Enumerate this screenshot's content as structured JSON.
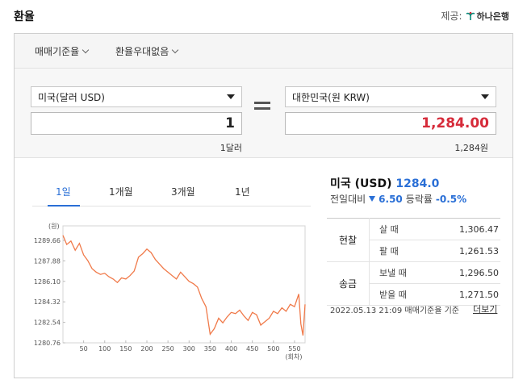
{
  "header": {
    "title": "환율",
    "provider_label": "제공:",
    "provider_name": "하나은행"
  },
  "options": {
    "rate_basis": "매매기준율",
    "preferential": "환율우대없음"
  },
  "converter": {
    "from_currency": "미국(달러 USD)",
    "from_amount": "1",
    "from_sub": "1달러",
    "to_currency": "대한민국(원 KRW)",
    "to_amount": "1,284.00",
    "to_sub": "1,284원"
  },
  "tabs": [
    {
      "label": "1일",
      "active": true
    },
    {
      "label": "1개월"
    },
    {
      "label": "3개월"
    },
    {
      "label": "1년"
    }
  ],
  "info": {
    "currency": "미국 (USD)",
    "rate": "1284.0",
    "change_label": "전일대비",
    "change_value": "6.50",
    "change_direction": "down",
    "pct_label": "등락률",
    "pct_value": "-0.5%"
  },
  "rates_table": {
    "groups": [
      {
        "name": "현찰",
        "rows": [
          {
            "label": "살 때",
            "value": "1,306.47"
          },
          {
            "label": "팔 때",
            "value": "1,261.53"
          }
        ]
      },
      {
        "name": "송금",
        "rows": [
          {
            "label": "보낼 때",
            "value": "1,296.50"
          },
          {
            "label": "받을 때",
            "value": "1,271.50"
          }
        ]
      }
    ]
  },
  "timestamp": "2022.05.13 21:09 매매기준율 기준",
  "more_link": "더보기",
  "colors": {
    "accent": "#2a6fd6",
    "to_amount": "#d62b3a",
    "line": "#f07a4a"
  },
  "chart_data": {
    "type": "line",
    "y_unit_label": "(원)",
    "x_unit_label": "(회차)",
    "ylim": [
      1280.76,
      1290.5
    ],
    "xlim": [
      1,
      575
    ],
    "yticks": [
      "1289.66",
      "1287.88",
      "1286.10",
      "1284.32",
      "1282.54",
      "1280.76"
    ],
    "xticks": [
      "50",
      "100",
      "150",
      "200",
      "250",
      "300",
      "350",
      "400",
      "450",
      "500",
      "550"
    ],
    "series": [
      {
        "color": "#f07a4a",
        "x": [
          1,
          10,
          20,
          30,
          40,
          50,
          60,
          70,
          80,
          90,
          100,
          110,
          120,
          130,
          140,
          150,
          160,
          170,
          180,
          190,
          200,
          210,
          220,
          230,
          240,
          250,
          260,
          270,
          280,
          290,
          300,
          310,
          320,
          330,
          340,
          350,
          360,
          370,
          380,
          390,
          400,
          410,
          420,
          430,
          440,
          450,
          460,
          470,
          480,
          490,
          500,
          510,
          520,
          530,
          540,
          550,
          560,
          565,
          570,
          575
        ],
        "y": [
          1290.1,
          1289.3,
          1289.6,
          1288.8,
          1289.4,
          1288.4,
          1287.9,
          1287.2,
          1286.9,
          1286.7,
          1286.8,
          1286.5,
          1286.3,
          1286.0,
          1286.4,
          1286.3,
          1286.6,
          1287.0,
          1288.2,
          1288.5,
          1288.9,
          1288.6,
          1288.0,
          1287.6,
          1287.2,
          1286.9,
          1286.6,
          1286.3,
          1286.9,
          1286.5,
          1286.1,
          1285.9,
          1285.6,
          1284.6,
          1283.9,
          1281.5,
          1282.0,
          1282.9,
          1282.5,
          1283.0,
          1283.4,
          1283.3,
          1283.6,
          1283.1,
          1282.7,
          1283.4,
          1283.2,
          1282.3,
          1282.6,
          1282.9,
          1283.5,
          1283.3,
          1283.8,
          1283.5,
          1284.1,
          1283.9,
          1285.0,
          1282.4,
          1281.4,
          1284.1
        ]
      }
    ]
  }
}
